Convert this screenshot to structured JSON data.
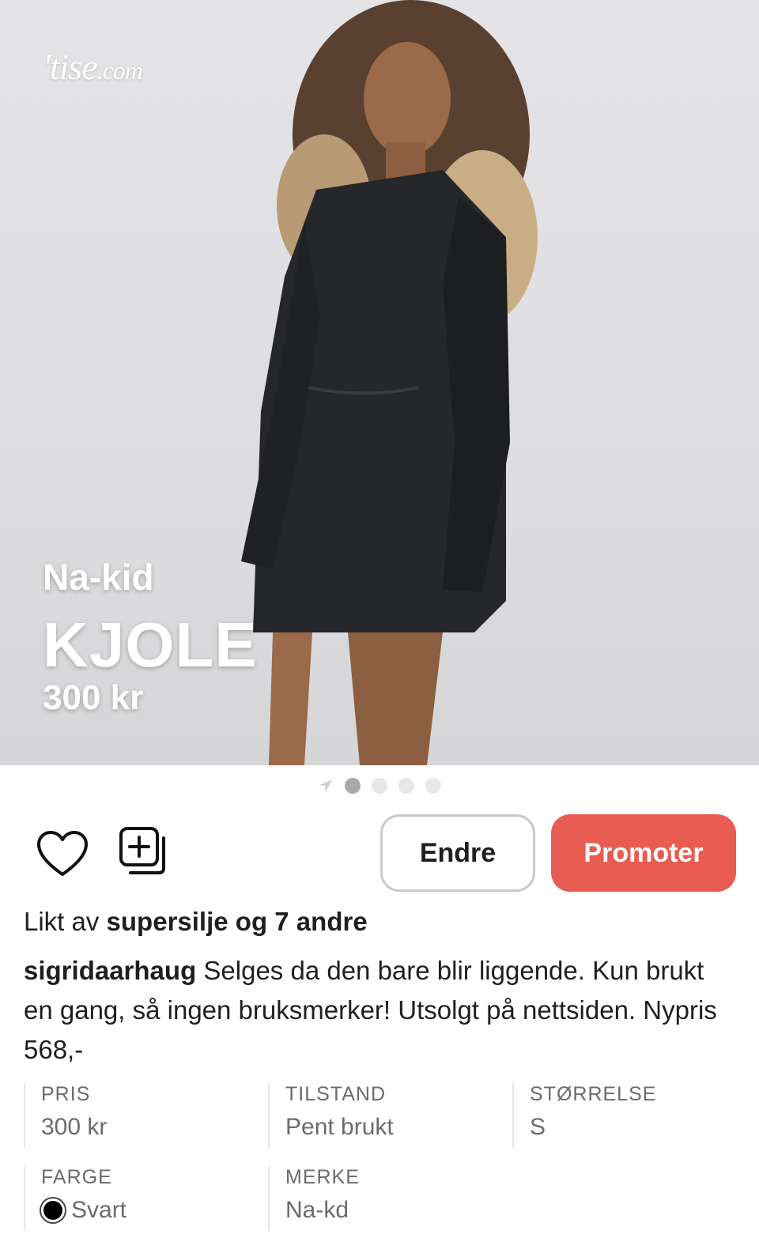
{
  "brand_logo": {
    "text": "'tise",
    "suffix": ".com"
  },
  "hero": {
    "brand": "Na-kid",
    "title": "KJOLE",
    "price": "300 kr"
  },
  "pager": {
    "count": 4,
    "active_index": 0
  },
  "actions": {
    "edit_label": "Endre",
    "promote_label": "Promoter",
    "promote_color": "#e85c52"
  },
  "likes": {
    "prefix": "Likt av",
    "user": "supersilje",
    "suffix": "og 7 andre"
  },
  "description": {
    "username": "sigridaarhaug",
    "text": "Selges da den bare blir liggende. Kun brukt en gang, så ingen bruksmerker! Utsolgt på nettsiden. Nypris 568,-"
  },
  "details": {
    "price": {
      "label": "PRIS",
      "value": "300 kr"
    },
    "condition": {
      "label": "TILSTAND",
      "value": "Pent brukt"
    },
    "size": {
      "label": "STØRRELSE",
      "value": "S"
    },
    "color": {
      "label": "FARGE",
      "value": "Svart",
      "swatch": "#000000"
    },
    "brand": {
      "label": "MERKE",
      "value": "Na-kd"
    }
  }
}
